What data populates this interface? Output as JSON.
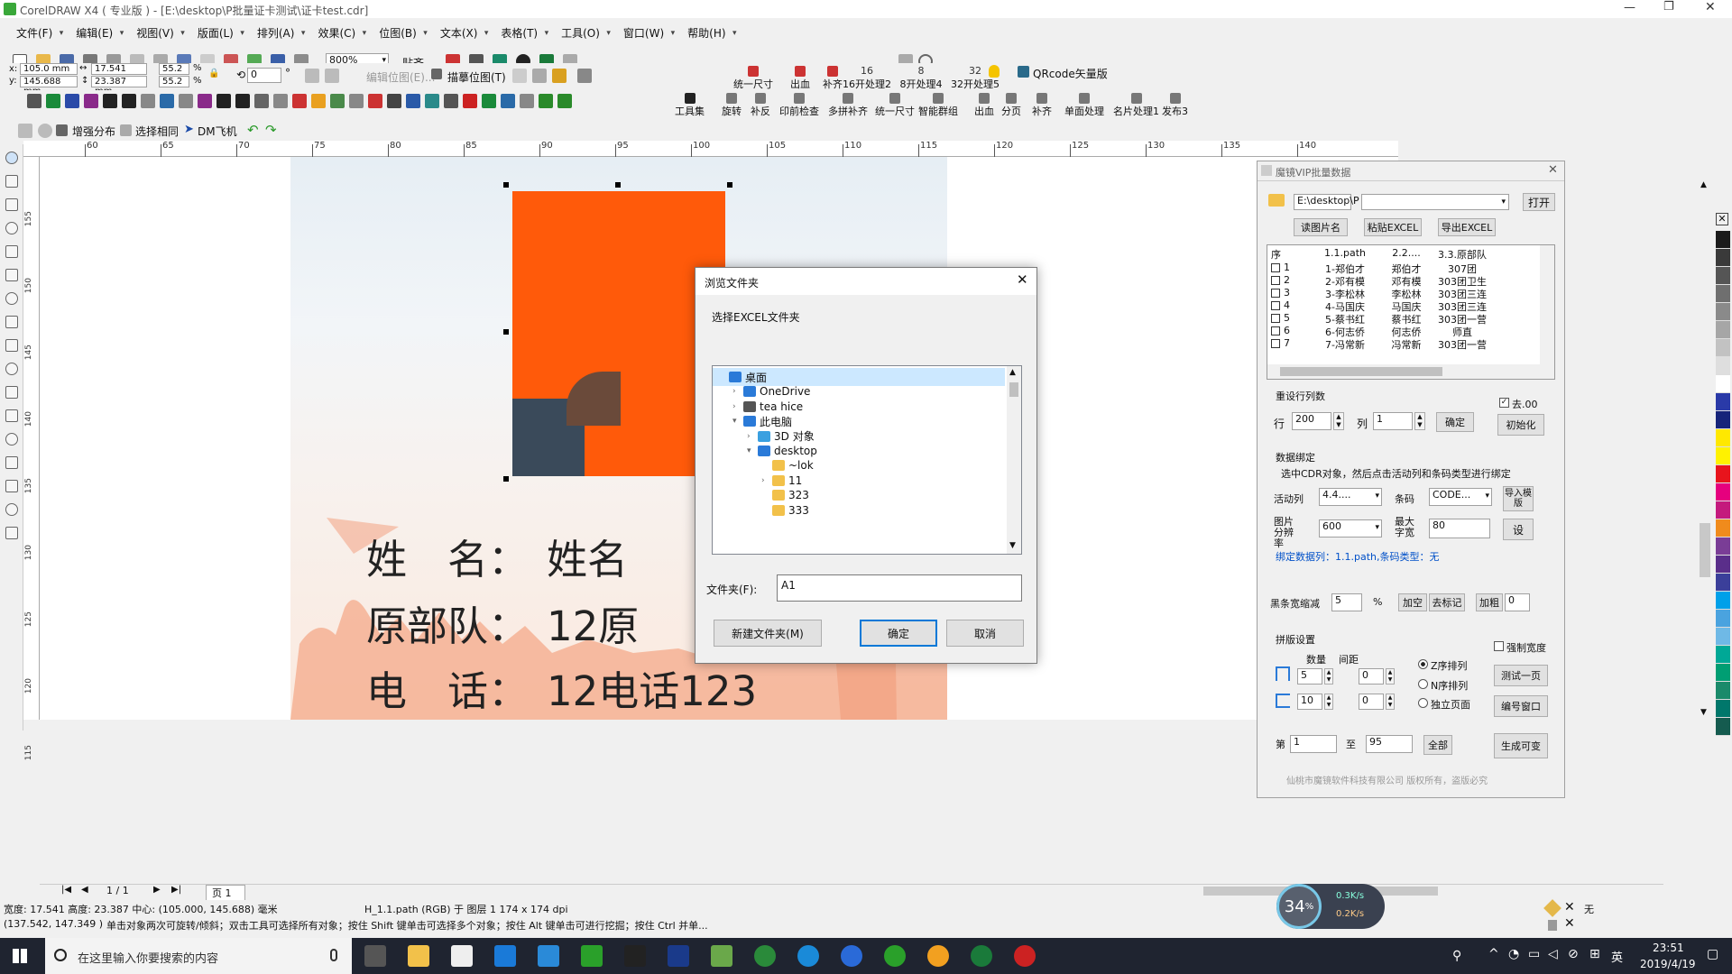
{
  "titlebar": {
    "title": "CorelDRAW X4 ( 专业版 ) - [E:\\desktop\\P批量证卡测试\\证卡test.cdr]"
  },
  "menu": [
    "文件(F)",
    "编辑(E)",
    "视图(V)",
    "版面(L)",
    "排列(A)",
    "效果(C)",
    "位图(B)",
    "文本(X)",
    "表格(T)",
    "工具(O)",
    "窗口(W)",
    "帮助(H)"
  ],
  "toolbar1": {
    "zoom": "800%",
    "snap": "贴齐"
  },
  "props": {
    "x": "105.0 mm",
    "y": "145.688 mm",
    "w": "17.541 mm",
    "h": "23.387 mm",
    "sx": "55.2",
    "sy": "55.2",
    "pct": "%",
    "angle": "0",
    "deg": "°",
    "edit_bitmap": "编辑位图(E)...",
    "trace_bitmap": "描摹位图(T)"
  },
  "plugin_row1": [
    "统一尺寸",
    "出血",
    "补齐",
    "16开处理2",
    "8开处理4",
    "32开处理5"
  ],
  "plugin_row1_nums": [
    "16",
    "8",
    "32"
  ],
  "qrcode": "QRcode矢量版",
  "plugin_row2": [
    "工具集",
    "旋转",
    "补反",
    "印前检查",
    "多拼补齐",
    "统一尺寸",
    "智能群组",
    "出血",
    "分页",
    "补齐",
    "单面处理",
    "名片处理1",
    "发布3"
  ],
  "toolbar3": [
    "增强分布",
    "选择相同",
    "DM飞机"
  ],
  "ruler": [
    "60",
    "65",
    "70",
    "75",
    "80",
    "85",
    "90",
    "95",
    "100",
    "105",
    "110",
    "115",
    "120",
    "125",
    "130",
    "135",
    "140"
  ],
  "vruler": [
    "155",
    "150",
    "145",
    "140",
    "135",
    "130",
    "125",
    "120",
    "115"
  ],
  "card": {
    "name_label": "姓　名：",
    "name_value": "姓名",
    "unit_label": "原部队：",
    "unit_value": "12原",
    "phone_label": "电　话：",
    "phone_value": "12电话123"
  },
  "dialog": {
    "title": "浏览文件夹",
    "prompt": "选择EXCEL文件夹",
    "tree": [
      {
        "label": "桌面",
        "indent": 0,
        "arrow": "",
        "icon": "desktop"
      },
      {
        "label": "OneDrive",
        "indent": 1,
        "arrow": ">",
        "icon": "cloud"
      },
      {
        "label": "tea hice",
        "indent": 1,
        "arrow": ">",
        "icon": "user"
      },
      {
        "label": "此电脑",
        "indent": 1,
        "arrow": "v",
        "icon": "pc"
      },
      {
        "label": "3D 对象",
        "indent": 2,
        "arrow": ">",
        "icon": "obj3d"
      },
      {
        "label": "desktop",
        "indent": 2,
        "arrow": "v",
        "icon": "desk"
      },
      {
        "label": "~lok",
        "indent": 3,
        "arrow": "",
        "icon": "folder"
      },
      {
        "label": "11",
        "indent": 3,
        "arrow": ">",
        "icon": "folder"
      },
      {
        "label": "323",
        "indent": 3,
        "arrow": "",
        "icon": "folder"
      },
      {
        "label": "333",
        "indent": 3,
        "arrow": "",
        "icon": "folder"
      }
    ],
    "folder_label": "文件夹(F):",
    "folder_value": "A1",
    "new_folder": "新建文件夹(M)",
    "ok": "确定",
    "cancel": "取消"
  },
  "panel": {
    "title": "魔镜VIP批量数据",
    "path": "E:\\desktop\\P",
    "open": "打开",
    "read_names": "读图片名",
    "paste_excel": "粘贴EXCEL",
    "export_excel": "导出EXCEL",
    "columns": [
      "序",
      "1.1.path",
      "2.2....",
      "3.3.原部队"
    ],
    "rows": [
      [
        "1",
        "1-郑伯才",
        "郑伯才",
        "307团"
      ],
      [
        "2",
        "2-邓有模",
        "邓有模",
        "303团卫生"
      ],
      [
        "3",
        "3-李松林",
        "李松林",
        "303团三连"
      ],
      [
        "4",
        "4-马国庆",
        "马国庆",
        "303团三连"
      ],
      [
        "5",
        "5-蔡书红",
        "蔡书红",
        "303团一营"
      ],
      [
        "6",
        "6-何志侨",
        "何志侨",
        "师直"
      ],
      [
        "7",
        "7-冯常新",
        "冯常新",
        "303团一营"
      ]
    ],
    "reset_label": "重设行列数",
    "dot00": "去.00",
    "row_label": "行",
    "row_value": "200",
    "col_label": "列",
    "col_value": "1",
    "confirm": "确定",
    "init": "初始化",
    "bind_label": "数据绑定",
    "bind_hint": "选中CDR对象，然后点击活动列和条码类型进行绑定",
    "active_col_label": "活动列",
    "active_col": "4.4....",
    "barcode_label": "条码",
    "barcode": "CODE...",
    "import_mod": "导入模版",
    "img_res_label": "图片分辨率",
    "img_res": "600",
    "max_width_label": "最大字宽",
    "max_width": "80",
    "set": "设",
    "bind_status": "绑定数据列：1.1.path,条码类型：无",
    "bar_shrink_label": "黑条宽缩减",
    "bar_shrink": "5",
    "pct": "%",
    "add_space": "加空",
    "remove_mark": "去标记",
    "thicken": "加粗",
    "thicken_value": "0",
    "layout_label": "拼版设置",
    "force_width": "强制宽度",
    "qty_label": "数量",
    "gap_label": "间距",
    "qty1": "5",
    "gap1": "0",
    "qty2": "10",
    "gap2": "0",
    "z_order": "Z序排列",
    "n_order": "N序排列",
    "single_page": "独立页面",
    "test_page": "测试一页",
    "number_window": "编号窗口",
    "page_from_label": "第",
    "page_from": "1",
    "page_to_label": "至",
    "page_to": "95",
    "all": "全部",
    "generate": "生成可变",
    "footer": "仙桃市魔镜软件科技有限公司 版权所有，盗版必究"
  },
  "pager": {
    "current": "1 / 1",
    "tab": "页 1"
  },
  "status": {
    "line1_dims": "宽度: 17.541 高度: 23.387 中心: (105.000, 145.688) 毫米",
    "line1_obj": "H_1.1.path (RGB) 于 图层 1 174 x 174 dpi",
    "line2_coords": "(137.542, 147.349 )",
    "line2_hint": "单击对象两次可旋转/倾斜；双击工具可选择所有对象；按住 Shift 键单击可选择多个对象；按住 Alt 键单击可进行挖掘；按住 Ctrl 并单...",
    "fill_none": "无"
  },
  "net": {
    "pct": "34",
    "pct_sign": "%",
    "up": "0.3K/s",
    "down": "0.2K/s"
  },
  "taskbar": {
    "search": "在这里输入你要搜索的内容",
    "time": "23:51",
    "date": "2019/4/19",
    "lang": "英"
  },
  "palette": [
    "#1b1b1b",
    "#3a3a3a",
    "#555555",
    "#6f6f6f",
    "#8a8a8a",
    "#a6a6a6",
    "#c2c2c2",
    "#dedede",
    "#ffffff",
    "#2a3aa8",
    "#16247a",
    "#ffe800",
    "#fff200",
    "#e8141c",
    "#e6007e",
    "#c41a7d",
    "#f08b1c",
    "#7a3d96",
    "#5a2e8a",
    "#3b3f9a",
    "#00a0e9",
    "#4aa3df",
    "#6fb9e6",
    "#00a896",
    "#009e73",
    "#1a8a6a",
    "#00776b",
    "#155b4f"
  ],
  "colors": {
    "orange": "#ff5a0a",
    "accent": "#0078d7",
    "panel_blue": "#0050c8"
  }
}
